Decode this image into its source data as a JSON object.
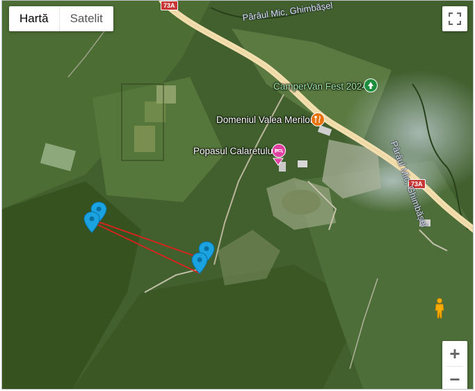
{
  "map_type": {
    "map_label": "Hartă",
    "satellite_label": "Satelit",
    "selected": "Satelit"
  },
  "controls": {
    "fullscreen_icon": "fullscreen-icon",
    "zoom_in_label": "+",
    "zoom_out_label": "−",
    "pegman_icon": "street-view-pegman-icon"
  },
  "places": {
    "campervan": {
      "name": "CamperVan Fest 2024",
      "icon": "tree-icon",
      "color": "#1e8e3e"
    },
    "valea": {
      "name": "Domeniul Valea Merilor",
      "icon": "restaurant-icon",
      "color": "#e8710a"
    },
    "popasul": {
      "name": "Popasul Calaretului",
      "icon": "hotel-bed-icon",
      "color": "#e040a0"
    }
  },
  "waterways": {
    "top": "Pârâul Mic, Ghimbășel",
    "right": "Pârâul Mic, Ghimbășel"
  },
  "roads": {
    "shield_top": "73A",
    "shield_right": "73A",
    "road_color": "#f2deae"
  },
  "markers": {
    "color": "#1aa3e0",
    "count": 4,
    "polygon_color": "#e0211d"
  }
}
